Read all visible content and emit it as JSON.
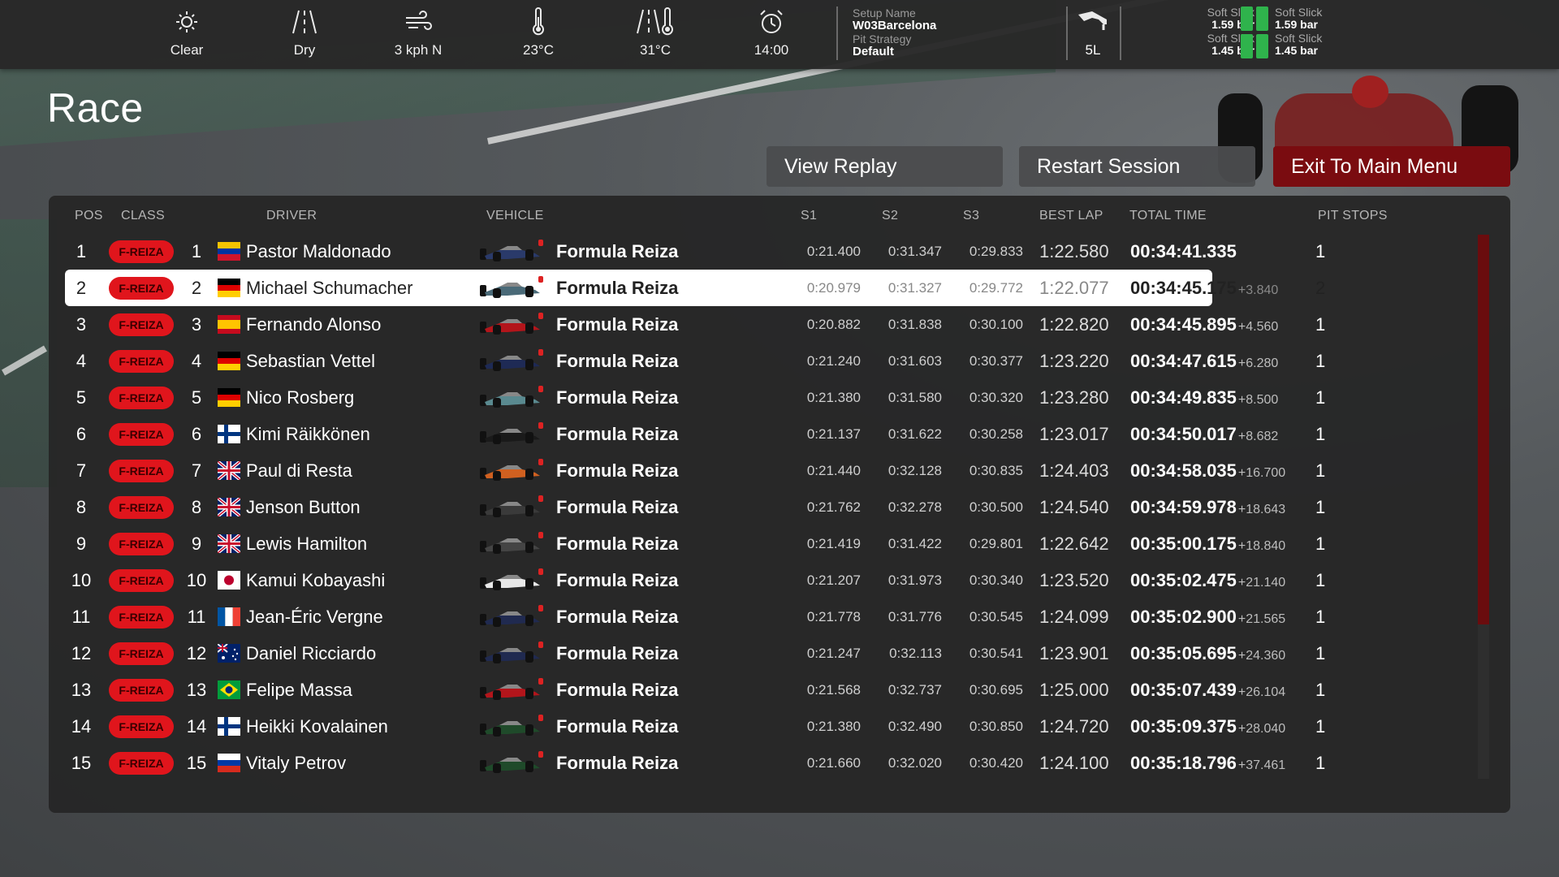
{
  "weather": {
    "items": [
      {
        "icon": "sun-icon",
        "label": "Clear"
      },
      {
        "icon": "road-dry-icon",
        "label": "Dry"
      },
      {
        "icon": "wind-icon",
        "label": "3 kph  N"
      },
      {
        "icon": "thermometer-icon",
        "label": "23°C"
      },
      {
        "icon": "track-temp-icon",
        "label": "31°C"
      },
      {
        "icon": "alarm-clock-icon",
        "label": "14:00"
      }
    ]
  },
  "setup": {
    "name_label": "Setup Name",
    "name_value": "W03Barcelona",
    "strategy_label": "Pit Strategy",
    "strategy_value": "Default"
  },
  "fuel": {
    "icon": "fuel-nozzle-icon",
    "label": "5L"
  },
  "tyres": {
    "fl": {
      "compound": "Soft Slick",
      "pressure": "1.59 bar"
    },
    "fr": {
      "compound": "Soft Slick",
      "pressure": "1.59 bar"
    },
    "rl": {
      "compound": "Soft Slick",
      "pressure": "1.45 bar"
    },
    "rr": {
      "compound": "Soft Slick",
      "pressure": "1.45 bar"
    },
    "status_color": "#2fb34c"
  },
  "page": {
    "title": "Race"
  },
  "buttons": {
    "view_replay": "View Replay",
    "restart_session": "Restart Session",
    "exit_main_menu": "Exit To Main Menu"
  },
  "table": {
    "headers": {
      "pos": "POS",
      "class": "CLASS",
      "driver": "DRIVER",
      "vehicle": "VEHICLE",
      "s1": "S1",
      "s2": "S2",
      "s3": "S3",
      "best_lap": "BEST LAP",
      "total_time": "TOTAL TIME",
      "pit_stops": "PIT STOPS"
    },
    "class_badge": "F-REIZA",
    "class_color": "#e0151c",
    "selected_row": 1,
    "rows": [
      {
        "pos": "1",
        "num": "1",
        "flag": "venezuela",
        "driver": "Pastor Maldonado",
        "vehicle": "Formula Reiza",
        "car_color": "#2a3a6a",
        "s1": "0:21.400",
        "s2": "0:31.347",
        "s3": "0:29.833",
        "best": "1:22.580",
        "total": "00:34:41.335",
        "gap": "",
        "pits": "1"
      },
      {
        "pos": "2",
        "num": "2",
        "flag": "germany",
        "driver": "Michael Schumacher",
        "vehicle": "Formula Reiza",
        "car_color": "#4a6a78",
        "s1": "0:20.979",
        "s2": "0:31.327",
        "s3": "0:29.772",
        "best": "1:22.077",
        "total": "00:34:45.175",
        "gap": "+3.840",
        "pits": "2"
      },
      {
        "pos": "3",
        "num": "3",
        "flag": "spain",
        "driver": "Fernando Alonso",
        "vehicle": "Formula Reiza",
        "car_color": "#b3151b",
        "s1": "0:20.882",
        "s2": "0:31.838",
        "s3": "0:30.100",
        "best": "1:22.820",
        "total": "00:34:45.895",
        "gap": "+4.560",
        "pits": "1"
      },
      {
        "pos": "4",
        "num": "4",
        "flag": "germany",
        "driver": "Sebastian Vettel",
        "vehicle": "Formula Reiza",
        "car_color": "#1e2a55",
        "s1": "0:21.240",
        "s2": "0:31.603",
        "s3": "0:30.377",
        "best": "1:23.220",
        "total": "00:34:47.615",
        "gap": "+6.280",
        "pits": "1"
      },
      {
        "pos": "5",
        "num": "5",
        "flag": "germany",
        "driver": "Nico Rosberg",
        "vehicle": "Formula Reiza",
        "car_color": "#5a8a90",
        "s1": "0:21.380",
        "s2": "0:31.580",
        "s3": "0:30.320",
        "best": "1:23.280",
        "total": "00:34:49.835",
        "gap": "+8.500",
        "pits": "1"
      },
      {
        "pos": "6",
        "num": "6",
        "flag": "finland",
        "driver": "Kimi Räikkönen",
        "vehicle": "Formula Reiza",
        "car_color": "#1a1a1a",
        "s1": "0:21.137",
        "s2": "0:31.622",
        "s3": "0:30.258",
        "best": "1:23.017",
        "total": "00:34:50.017",
        "gap": "+8.682",
        "pits": "1"
      },
      {
        "pos": "7",
        "num": "7",
        "flag": "uk",
        "driver": "Paul di Resta",
        "vehicle": "Formula Reiza",
        "car_color": "#d06020",
        "s1": "0:21.440",
        "s2": "0:32.128",
        "s3": "0:30.835",
        "best": "1:24.403",
        "total": "00:34:58.035",
        "gap": "+16.700",
        "pits": "1"
      },
      {
        "pos": "8",
        "num": "8",
        "flag": "uk",
        "driver": "Jenson Button",
        "vehicle": "Formula Reiza",
        "car_color": "#3a3a3a",
        "s1": "0:21.762",
        "s2": "0:32.278",
        "s3": "0:30.500",
        "best": "1:24.540",
        "total": "00:34:59.978",
        "gap": "+18.643",
        "pits": "1"
      },
      {
        "pos": "9",
        "num": "9",
        "flag": "uk",
        "driver": "Lewis Hamilton",
        "vehicle": "Formula Reiza",
        "car_color": "#444444",
        "s1": "0:21.419",
        "s2": "0:31.422",
        "s3": "0:29.801",
        "best": "1:22.642",
        "total": "00:35:00.175",
        "gap": "+18.840",
        "pits": "1"
      },
      {
        "pos": "10",
        "num": "10",
        "flag": "japan",
        "driver": "Kamui Kobayashi",
        "vehicle": "Formula Reiza",
        "car_color": "#e8e8e8",
        "s1": "0:21.207",
        "s2": "0:31.973",
        "s3": "0:30.340",
        "best": "1:23.520",
        "total": "00:35:02.475",
        "gap": "+21.140",
        "pits": "1"
      },
      {
        "pos": "11",
        "num": "11",
        "flag": "france",
        "driver": "Jean-Éric Vergne",
        "vehicle": "Formula Reiza",
        "car_color": "#202a50",
        "s1": "0:21.778",
        "s2": "0:31.776",
        "s3": "0:30.545",
        "best": "1:24.099",
        "total": "00:35:02.900",
        "gap": "+21.565",
        "pits": "1"
      },
      {
        "pos": "12",
        "num": "12",
        "flag": "australia",
        "driver": "Daniel Ricciardo",
        "vehicle": "Formula Reiza",
        "car_color": "#202a50",
        "s1": "0:21.247",
        "s2": "0:32.113",
        "s3": "0:30.541",
        "best": "1:23.901",
        "total": "00:35:05.695",
        "gap": "+24.360",
        "pits": "1"
      },
      {
        "pos": "13",
        "num": "13",
        "flag": "brazil",
        "driver": "Felipe Massa",
        "vehicle": "Formula Reiza",
        "car_color": "#b3151b",
        "s1": "0:21.568",
        "s2": "0:32.737",
        "s3": "0:30.695",
        "best": "1:25.000",
        "total": "00:35:07.439",
        "gap": "+26.104",
        "pits": "1"
      },
      {
        "pos": "14",
        "num": "14",
        "flag": "finland",
        "driver": "Heikki Kovalainen",
        "vehicle": "Formula Reiza",
        "car_color": "#1f4a2a",
        "s1": "0:21.380",
        "s2": "0:32.490",
        "s3": "0:30.850",
        "best": "1:24.720",
        "total": "00:35:09.375",
        "gap": "+28.040",
        "pits": "1"
      },
      {
        "pos": "15",
        "num": "15",
        "flag": "russia",
        "driver": "Vitaly Petrov",
        "vehicle": "Formula Reiza",
        "car_color": "#1f4a2a",
        "s1": "0:21.660",
        "s2": "0:32.020",
        "s3": "0:30.420",
        "best": "1:24.100",
        "total": "00:35:18.796",
        "gap": "+37.461",
        "pits": "1"
      }
    ]
  }
}
